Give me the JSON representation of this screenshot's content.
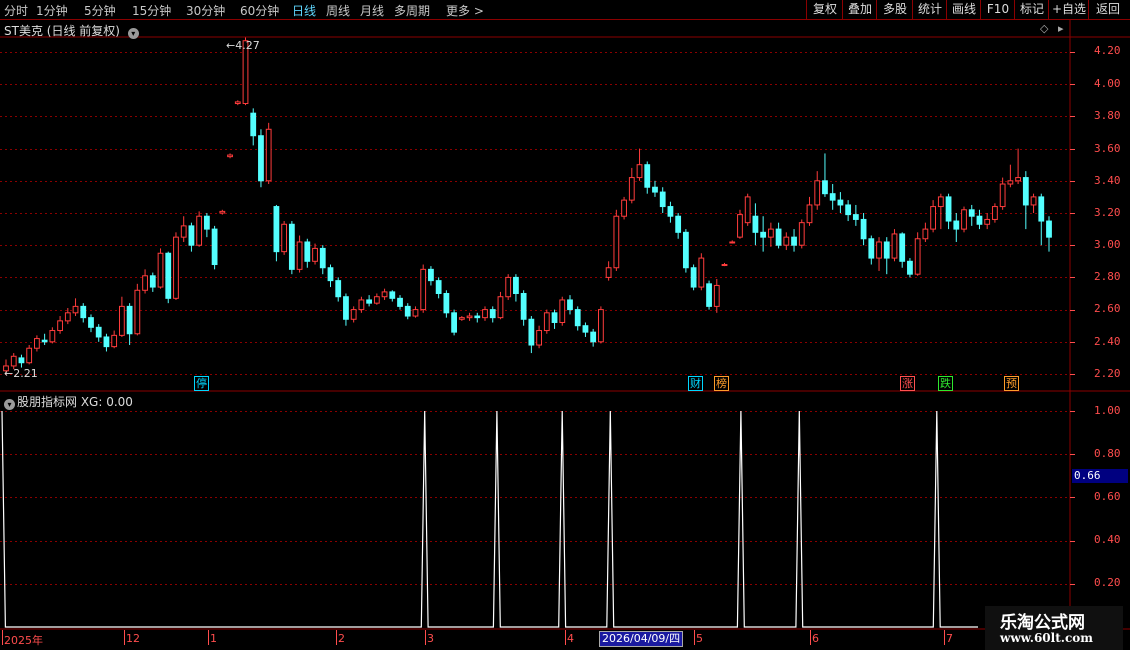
{
  "toolbar": {
    "timeframes": [
      "分时",
      "1分钟",
      "5分钟",
      "15分钟",
      "30分钟",
      "60分钟",
      "日线",
      "周线",
      "月线",
      "多周期",
      "更多 >"
    ],
    "active": "日线",
    "right_buttons": [
      "复权",
      "叠加",
      "多股",
      "统计",
      "画线",
      "F10",
      "标记",
      "+自选",
      "返回"
    ]
  },
  "main_panel": {
    "title": "ST美克 (日线 前复权)",
    "high_label": "4.27",
    "low_label": "2.21",
    "y_axis": [
      "4.20",
      "4.00",
      "3.80",
      "3.60",
      "3.40",
      "3.20",
      "3.00",
      "2.80",
      "2.60",
      "2.40",
      "2.20"
    ],
    "tags": [
      {
        "text": "停",
        "color": "#00d7ff"
      },
      {
        "text": "财",
        "color": "#00d7ff"
      },
      {
        "text": "榜",
        "color": "#ff9c2a"
      },
      {
        "text": "涨",
        "color": "#ff5050"
      },
      {
        "text": "跌",
        "color": "#2ee82e"
      },
      {
        "text": "预",
        "color": "#ff9c2a"
      }
    ]
  },
  "indicator_panel": {
    "title": "股朋指标网 XG: 0.00",
    "y_axis": [
      "1.00",
      "0.80",
      "0.60",
      "0.40",
      "0.20"
    ],
    "current_value": "0.66"
  },
  "date_axis": {
    "labels": [
      "2025年",
      "12",
      "1",
      "2",
      "3",
      "4",
      "5",
      "6",
      "7"
    ],
    "highlighted_date": "2026/04/09/四"
  },
  "watermark": {
    "line1": "乐淘公式网",
    "line2": "www.60lt.com"
  },
  "colors": {
    "up": "#ff3c3c",
    "down": "#54ffff",
    "grid": "#8b0000",
    "signal": "#ffffff"
  },
  "chart_data": {
    "type": "candlestick",
    "price_ylim": [
      2.15,
      4.35
    ],
    "indicator_ylim": [
      0,
      1
    ],
    "ohlc": [
      [
        2.22,
        2.25,
        2.29,
        2.2
      ],
      [
        2.25,
        2.31,
        2.33,
        2.23
      ],
      [
        2.3,
        2.27,
        2.32,
        2.24
      ],
      [
        2.27,
        2.36,
        2.38,
        2.26
      ],
      [
        2.36,
        2.42,
        2.44,
        2.34
      ],
      [
        2.41,
        2.4,
        2.45,
        2.38
      ],
      [
        2.4,
        2.47,
        2.49,
        2.39
      ],
      [
        2.47,
        2.53,
        2.56,
        2.45
      ],
      [
        2.53,
        2.58,
        2.61,
        2.51
      ],
      [
        2.58,
        2.62,
        2.67,
        2.56
      ],
      [
        2.62,
        2.55,
        2.64,
        2.52
      ],
      [
        2.55,
        2.49,
        2.57,
        2.46
      ],
      [
        2.49,
        2.43,
        2.51,
        2.4
      ],
      [
        2.43,
        2.37,
        2.45,
        2.34
      ],
      [
        2.37,
        2.44,
        2.47,
        2.36
      ],
      [
        2.44,
        2.62,
        2.68,
        2.43
      ],
      [
        2.62,
        2.45,
        2.64,
        2.38
      ],
      [
        2.45,
        2.72,
        2.76,
        2.44
      ],
      [
        2.72,
        2.81,
        2.85,
        2.7
      ],
      [
        2.81,
        2.74,
        2.83,
        2.71
      ],
      [
        2.74,
        2.95,
        2.98,
        2.73
      ],
      [
        2.95,
        2.67,
        2.96,
        2.64
      ],
      [
        2.67,
        3.05,
        3.08,
        2.66
      ],
      [
        3.05,
        3.12,
        3.18,
        3.02
      ],
      [
        3.12,
        3.0,
        3.14,
        2.96
      ],
      [
        3.0,
        3.18,
        3.21,
        2.99
      ],
      [
        3.18,
        3.1,
        3.2,
        3.05
      ],
      [
        3.1,
        2.88,
        3.12,
        2.85
      ],
      [
        3.2,
        3.21,
        3.22,
        3.19
      ],
      [
        3.55,
        3.56,
        3.57,
        3.54
      ],
      [
        3.88,
        3.89,
        3.9,
        3.87
      ],
      [
        3.88,
        4.27,
        4.29,
        3.87
      ],
      [
        3.82,
        3.68,
        3.85,
        3.62
      ],
      [
        3.68,
        3.4,
        3.72,
        3.36
      ],
      [
        3.4,
        3.72,
        3.76,
        3.38
      ],
      [
        3.24,
        2.96,
        3.25,
        2.9
      ],
      [
        2.96,
        3.13,
        3.15,
        2.94
      ],
      [
        3.13,
        2.85,
        3.15,
        2.82
      ],
      [
        2.85,
        3.02,
        3.06,
        2.83
      ],
      [
        3.02,
        2.9,
        3.04,
        2.86
      ],
      [
        2.9,
        2.98,
        3.01,
        2.88
      ],
      [
        2.98,
        2.86,
        3.0,
        2.82
      ],
      [
        2.86,
        2.78,
        2.88,
        2.74
      ],
      [
        2.78,
        2.68,
        2.8,
        2.65
      ],
      [
        2.68,
        2.54,
        2.7,
        2.5
      ],
      [
        2.54,
        2.6,
        2.62,
        2.52
      ],
      [
        2.6,
        2.66,
        2.68,
        2.58
      ],
      [
        2.66,
        2.64,
        2.69,
        2.62
      ],
      [
        2.64,
        2.68,
        2.7,
        2.63
      ],
      [
        2.68,
        2.71,
        2.73,
        2.66
      ],
      [
        2.71,
        2.67,
        2.72,
        2.65
      ],
      [
        2.67,
        2.62,
        2.69,
        2.6
      ],
      [
        2.62,
        2.56,
        2.64,
        2.54
      ],
      [
        2.56,
        2.6,
        2.62,
        2.55
      ],
      [
        2.6,
        2.85,
        2.88,
        2.58
      ],
      [
        2.85,
        2.78,
        2.87,
        2.75
      ],
      [
        2.78,
        2.7,
        2.8,
        2.67
      ],
      [
        2.7,
        2.58,
        2.72,
        2.55
      ],
      [
        2.58,
        2.46,
        2.6,
        2.44
      ],
      [
        2.54,
        2.55,
        2.56,
        2.53
      ],
      [
        2.55,
        2.56,
        2.58,
        2.53
      ],
      [
        2.56,
        2.55,
        2.58,
        2.52
      ],
      [
        2.55,
        2.6,
        2.62,
        2.53
      ],
      [
        2.6,
        2.55,
        2.62,
        2.52
      ],
      [
        2.55,
        2.68,
        2.71,
        2.54
      ],
      [
        2.68,
        2.8,
        2.82,
        2.66
      ],
      [
        2.8,
        2.7,
        2.82,
        2.65
      ],
      [
        2.7,
        2.54,
        2.72,
        2.5
      ],
      [
        2.54,
        2.38,
        2.56,
        2.33
      ],
      [
        2.38,
        2.47,
        2.5,
        2.36
      ],
      [
        2.47,
        2.58,
        2.6,
        2.45
      ],
      [
        2.58,
        2.52,
        2.6,
        2.48
      ],
      [
        2.52,
        2.66,
        2.68,
        2.5
      ],
      [
        2.66,
        2.6,
        2.69,
        2.57
      ],
      [
        2.6,
        2.5,
        2.62,
        2.47
      ],
      [
        2.5,
        2.46,
        2.52,
        2.43
      ],
      [
        2.46,
        2.4,
        2.48,
        2.37
      ],
      [
        2.4,
        2.6,
        2.62,
        2.39
      ],
      [
        2.8,
        2.86,
        2.9,
        2.78
      ],
      [
        2.86,
        3.18,
        3.22,
        2.84
      ],
      [
        3.18,
        3.28,
        3.3,
        3.16
      ],
      [
        3.28,
        3.42,
        3.48,
        3.26
      ],
      [
        3.42,
        3.5,
        3.6,
        3.4
      ],
      [
        3.5,
        3.36,
        3.52,
        3.32
      ],
      [
        3.36,
        3.33,
        3.4,
        3.3
      ],
      [
        3.33,
        3.24,
        3.36,
        3.2
      ],
      [
        3.24,
        3.18,
        3.27,
        3.14
      ],
      [
        3.18,
        3.08,
        3.2,
        3.04
      ],
      [
        3.08,
        2.86,
        3.1,
        2.83
      ],
      [
        2.86,
        2.74,
        2.88,
        2.72
      ],
      [
        2.74,
        2.92,
        2.95,
        2.72
      ],
      [
        2.76,
        2.62,
        2.78,
        2.6
      ],
      [
        2.62,
        2.75,
        2.79,
        2.58
      ],
      [
        2.88,
        2.88,
        2.89,
        2.87
      ],
      [
        3.02,
        3.02,
        3.03,
        3.01
      ],
      [
        3.05,
        3.19,
        3.22,
        3.04
      ],
      [
        3.14,
        3.3,
        3.32,
        3.12
      ],
      [
        3.18,
        3.08,
        3.26,
        3.0
      ],
      [
        3.08,
        3.05,
        3.18,
        2.96
      ],
      [
        3.05,
        3.1,
        3.14,
        2.99
      ],
      [
        3.1,
        3.0,
        3.14,
        2.98
      ],
      [
        3.0,
        3.05,
        3.08,
        2.97
      ],
      [
        3.05,
        3.0,
        3.1,
        2.96
      ],
      [
        3.0,
        3.14,
        3.16,
        2.98
      ],
      [
        3.14,
        3.25,
        3.3,
        3.12
      ],
      [
        3.25,
        3.4,
        3.46,
        3.22
      ],
      [
        3.4,
        3.32,
        3.57,
        3.3
      ],
      [
        3.32,
        3.28,
        3.38,
        3.22
      ],
      [
        3.28,
        3.25,
        3.33,
        3.2
      ],
      [
        3.25,
        3.19,
        3.28,
        3.15
      ],
      [
        3.19,
        3.16,
        3.25,
        3.12
      ],
      [
        3.16,
        3.04,
        3.2,
        3.0
      ],
      [
        3.04,
        2.92,
        3.06,
        2.88
      ],
      [
        2.92,
        3.02,
        3.05,
        2.84
      ],
      [
        3.02,
        2.92,
        3.05,
        2.82
      ],
      [
        2.92,
        3.07,
        3.1,
        2.9
      ],
      [
        3.07,
        2.9,
        3.08,
        2.86
      ],
      [
        2.9,
        2.82,
        2.92,
        2.8
      ],
      [
        2.82,
        3.04,
        3.08,
        2.81
      ],
      [
        3.04,
        3.1,
        3.14,
        3.02
      ],
      [
        3.1,
        3.24,
        3.28,
        3.08
      ],
      [
        3.24,
        3.3,
        3.32,
        3.1
      ],
      [
        3.3,
        3.15,
        3.32,
        3.1
      ],
      [
        3.15,
        3.1,
        3.2,
        3.02
      ],
      [
        3.1,
        3.22,
        3.24,
        3.08
      ],
      [
        3.22,
        3.18,
        3.25,
        3.12
      ],
      [
        3.18,
        3.13,
        3.22,
        3.1
      ],
      [
        3.13,
        3.16,
        3.2,
        3.1
      ],
      [
        3.16,
        3.24,
        3.26,
        3.14
      ],
      [
        3.24,
        3.38,
        3.42,
        3.22
      ],
      [
        3.38,
        3.4,
        3.5,
        3.36
      ],
      [
        3.4,
        3.42,
        3.6,
        3.38
      ],
      [
        3.42,
        3.25,
        3.46,
        3.1
      ],
      [
        3.25,
        3.3,
        3.32,
        3.2
      ],
      [
        3.3,
        3.15,
        3.32,
        3.0
      ],
      [
        3.15,
        3.05,
        3.18,
        2.96
      ]
    ],
    "indicator_spikes": [
      0,
      123,
      144,
      163,
      177,
      215,
      232,
      272
    ],
    "indicator_n": 285
  }
}
